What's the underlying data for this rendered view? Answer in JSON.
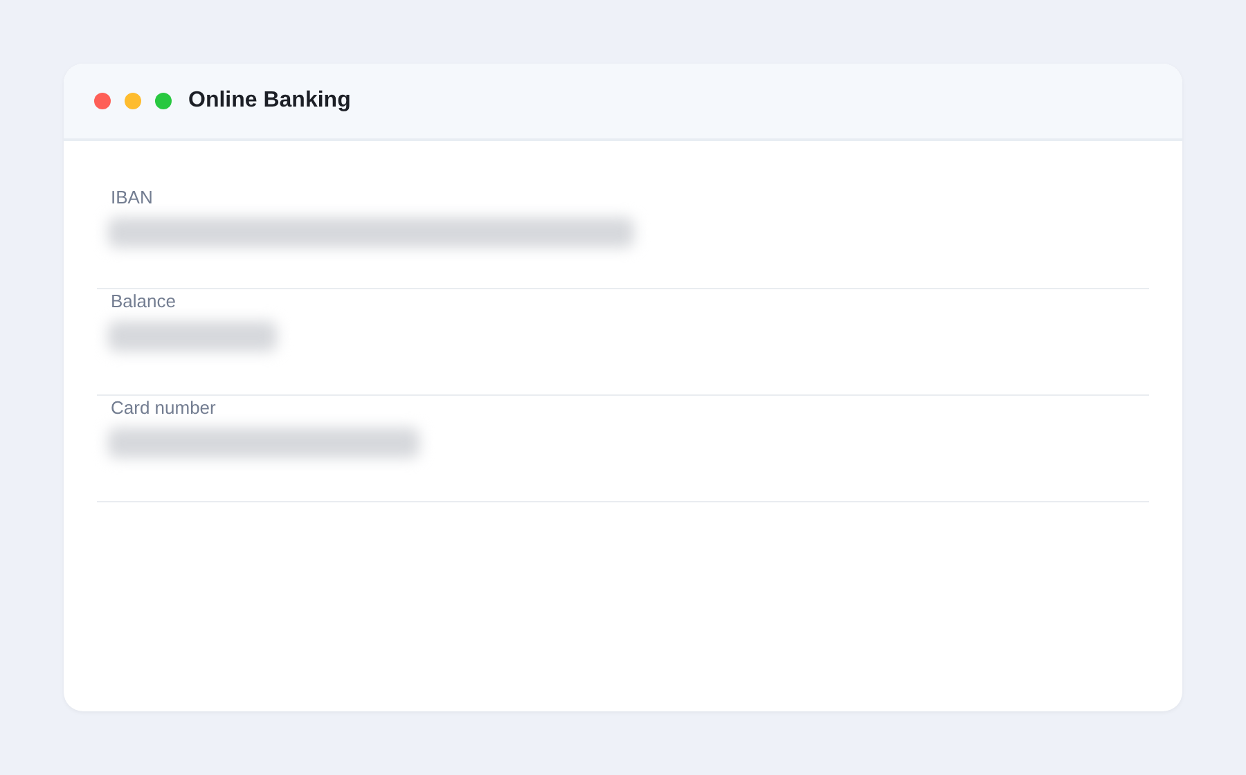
{
  "window": {
    "title": "Online Banking"
  },
  "fields": [
    {
      "label": "IBAN",
      "blurred": true
    },
    {
      "label": "Balance",
      "blurred": true
    },
    {
      "label": "Card number",
      "blurred": true
    }
  ]
}
